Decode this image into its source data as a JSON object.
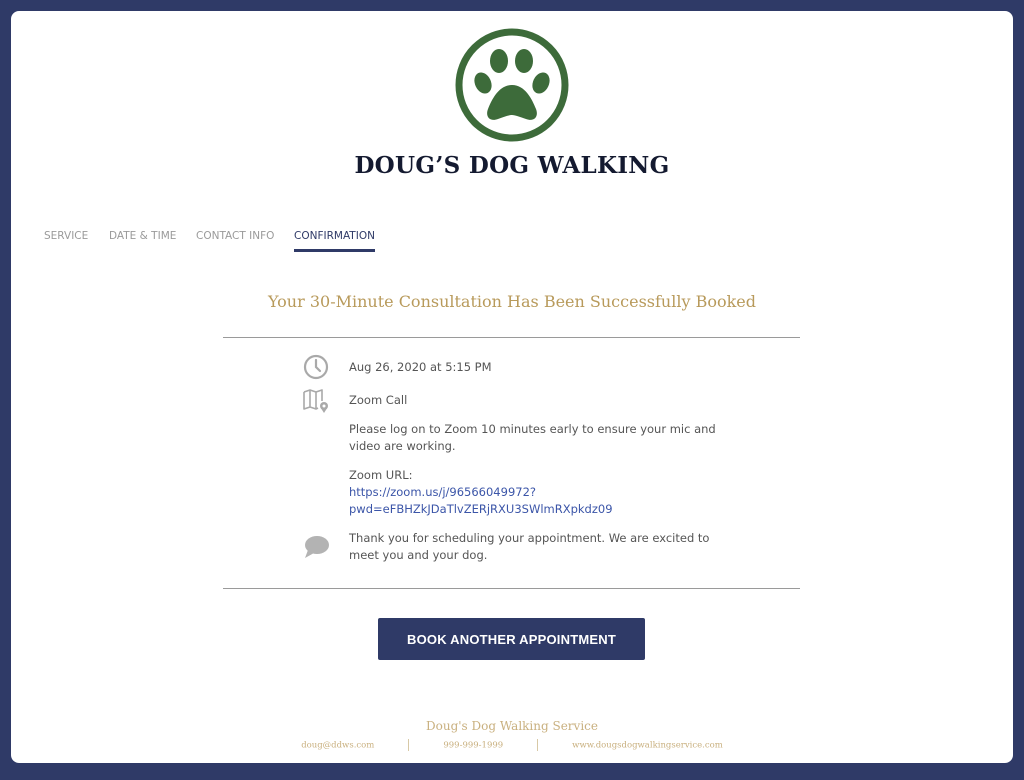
{
  "brand": {
    "name": "DOUG’S DOG WALKING",
    "logo_icon": "paw-print-icon",
    "brand_color": "#3d6b3a"
  },
  "tabs": [
    {
      "label": "SERVICE",
      "active": false
    },
    {
      "label": "DATE & TIME",
      "active": false
    },
    {
      "label": "CONTACT INFO",
      "active": false
    },
    {
      "label": "CONFIRMATION",
      "active": true
    }
  ],
  "confirmation": {
    "title": "Your 30-Minute Consultation Has Been Successfully Booked",
    "datetime": "Aug 26, 2020 at 5:15 PM",
    "location": "Zoom Call",
    "instructions": "Please log on to Zoom 10 minutes early to ensure your mic and video are working.",
    "zoom_url_label": "Zoom URL:",
    "zoom_url_line1": "https://zoom.us/j/96566049972?",
    "zoom_url_line2": "pwd=eFBHZkJDaTlvZERjRXU3SWlmRXpkdz09",
    "message": "Thank you for scheduling your appointment. We are excited to meet you and your dog."
  },
  "icons": {
    "datetime": "clock-icon",
    "location": "map-pin-icon",
    "message": "chat-bubble-icon"
  },
  "actions": {
    "book_another_label": "BOOK ANOTHER APPOINTMENT"
  },
  "footer": {
    "business_name": "Doug's Dog Walking Service",
    "email": "doug@ddws.com",
    "phone": "999-999-1999",
    "website": "www.dougsdogwalkingservice.com"
  },
  "colors": {
    "accent": "#2f3a67",
    "gold": "#b89a5b",
    "link": "#3b55a8"
  }
}
